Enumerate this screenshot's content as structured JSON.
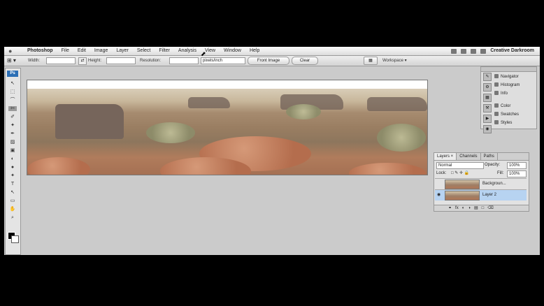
{
  "menubar": {
    "apple": "",
    "items": [
      "Photoshop",
      "File",
      "Edit",
      "Image",
      "Layer",
      "Select",
      "Filter",
      "Analysis",
      "View",
      "Window",
      "Help"
    ],
    "user": "Creative Darkroom"
  },
  "options_bar": {
    "tool_icon": "crop-tool",
    "width_label": "Width:",
    "height_label": "Height:",
    "resolution_label": "Resolution:",
    "units_value": "pixels/inch",
    "front_image_label": "Front Image",
    "clear_label": "Clear",
    "workspace_label": "Workspace ▾"
  },
  "toolbox": {
    "badge": "Ps",
    "tool_glyphs": [
      "↖",
      "⬚",
      "⌒",
      "✄",
      "✐",
      "✦",
      "✒",
      "▨",
      "▣",
      "◐",
      "●",
      "✦",
      "T",
      "↖",
      "▭",
      "✋",
      "⌕"
    ]
  },
  "dock": {
    "items": [
      "Navigator",
      "Histogram",
      "Info",
      "Color",
      "Swatches",
      "Styles"
    ]
  },
  "layers_panel": {
    "tabs": [
      "Layers ×",
      "Channels",
      "Paths"
    ],
    "blend_mode": "Normal",
    "opacity_label": "Opacity:",
    "opacity_value": "100%",
    "lock_label": "Lock:",
    "fill_label": "Fill:",
    "fill_value": "100%",
    "layers": [
      {
        "name": "Backgroun...",
        "visible": false,
        "active": false
      },
      {
        "name": "Layer 2",
        "visible": true,
        "active": true
      }
    ],
    "footer_icons": [
      "link-icon",
      "fx-icon",
      "mask-icon",
      "adjustment-icon",
      "folder-icon",
      "new-layer-icon",
      "trash-icon"
    ]
  }
}
